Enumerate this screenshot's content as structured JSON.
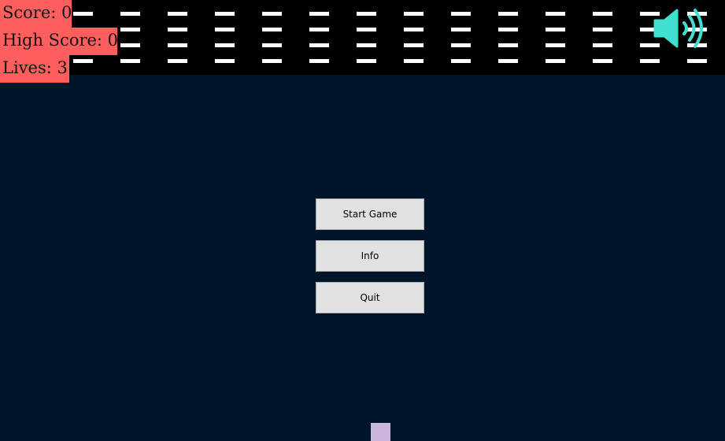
{
  "hud": {
    "score_label": "Score: 0",
    "high_score_label": "High Score: 0",
    "lives_label": "Lives: 3"
  },
  "menu": {
    "start_label": "Start Game",
    "info_label": "Info",
    "quit_label": "Quit"
  },
  "sound": {
    "icon": "speaker-volume-icon",
    "state": "on"
  },
  "bricks": {
    "columns": 15,
    "rows": 4
  },
  "colors": {
    "background": "#00142a",
    "brick_band": "#000000",
    "brick": "#ffffff",
    "hud_label_bg": "#ff5e5e",
    "sound_icon": "#40e0d0",
    "button_bg": "#e1e1e1",
    "paddle": "#cbb5dc"
  }
}
